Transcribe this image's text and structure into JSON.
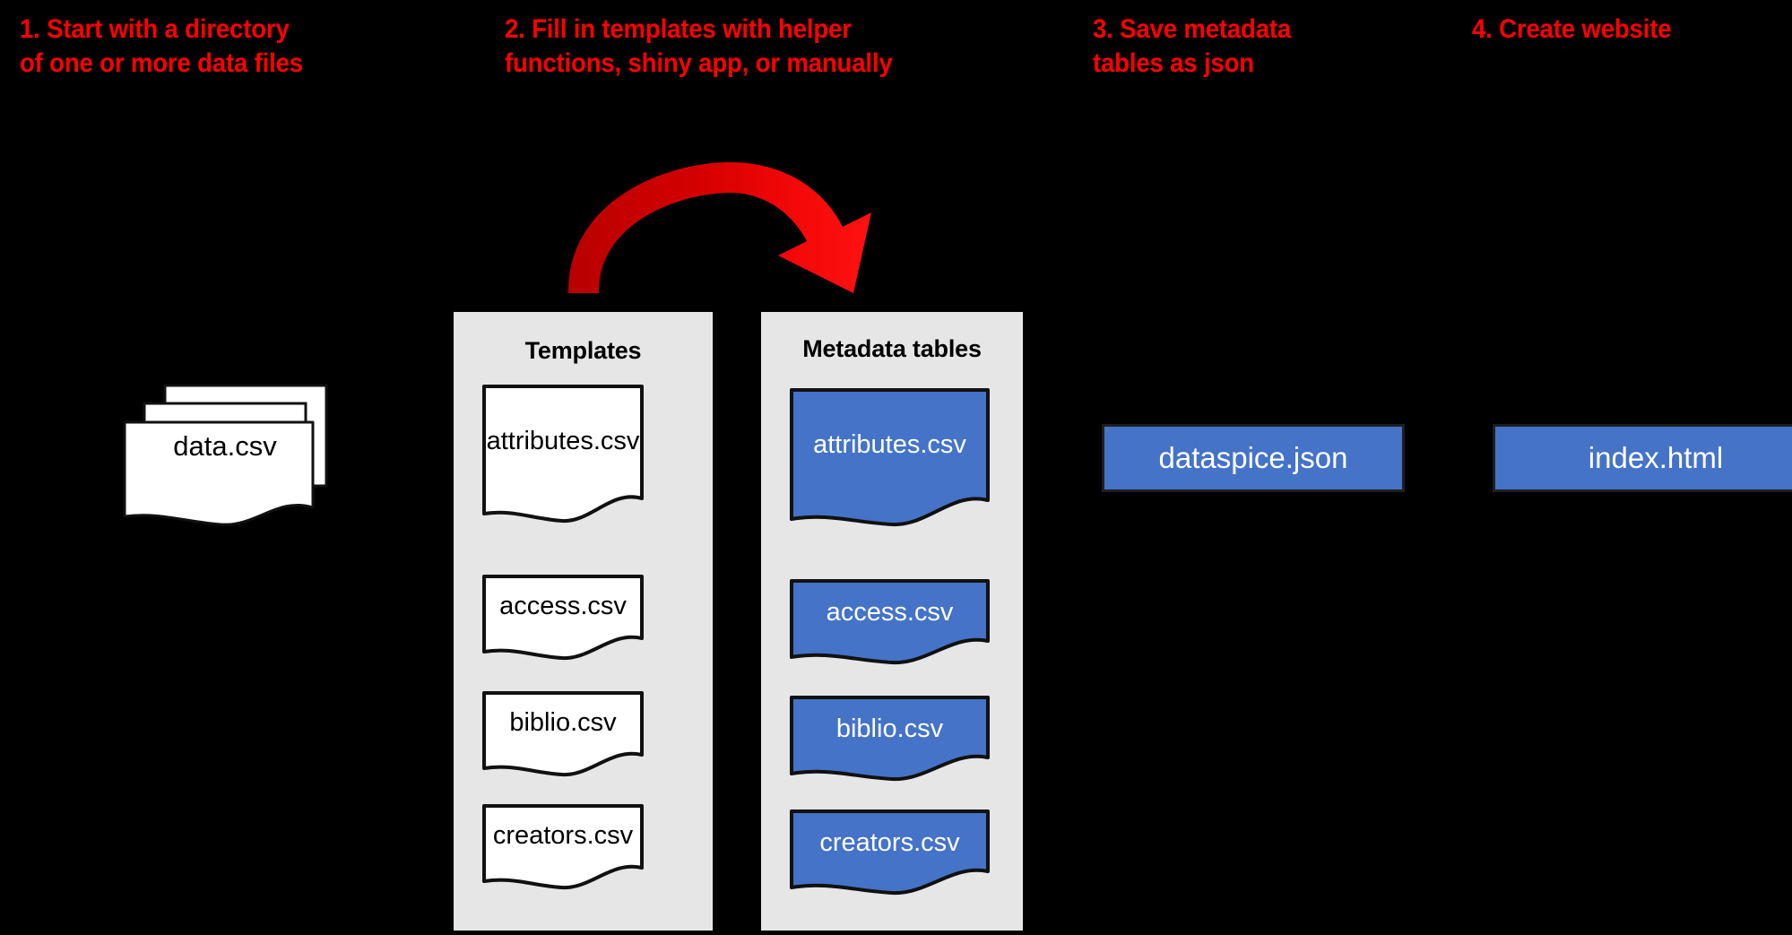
{
  "background_color": "#000000",
  "accent_color": "#FF0000",
  "panel_color": "#E6E6E6",
  "blue_color": "#4473C8",
  "steps": [
    {
      "id": "step-1",
      "text": "1. Start with a directory\nof one or more data files"
    },
    {
      "id": "step-2",
      "text": "2. Fill in templates with helper\nfunctions, shiny app, or manually"
    },
    {
      "id": "step-3",
      "text": "3. Save metadata\ntables as json"
    },
    {
      "id": "step-4",
      "text": "4. Create website"
    }
  ],
  "data_stack": {
    "label": "data.csv",
    "file_count": 3
  },
  "templates_panel": {
    "title": "Templates",
    "documents": [
      {
        "label": "attributes.csv"
      },
      {
        "label": "access.csv"
      },
      {
        "label": "biblio.csv"
      },
      {
        "label": "creators.csv"
      }
    ]
  },
  "metadata_panel": {
    "title": "Metadata tables",
    "documents": [
      {
        "label": "attributes.csv"
      },
      {
        "label": "access.csv"
      },
      {
        "label": "biblio.csv"
      },
      {
        "label": "creators.csv"
      }
    ]
  },
  "outputs": [
    {
      "label": "dataspice.json"
    },
    {
      "label": "index.html"
    }
  ],
  "arrow": {
    "name": "templates-to-metadata-arrow",
    "color_start": "#BB0000",
    "color_end": "#FF1111"
  }
}
